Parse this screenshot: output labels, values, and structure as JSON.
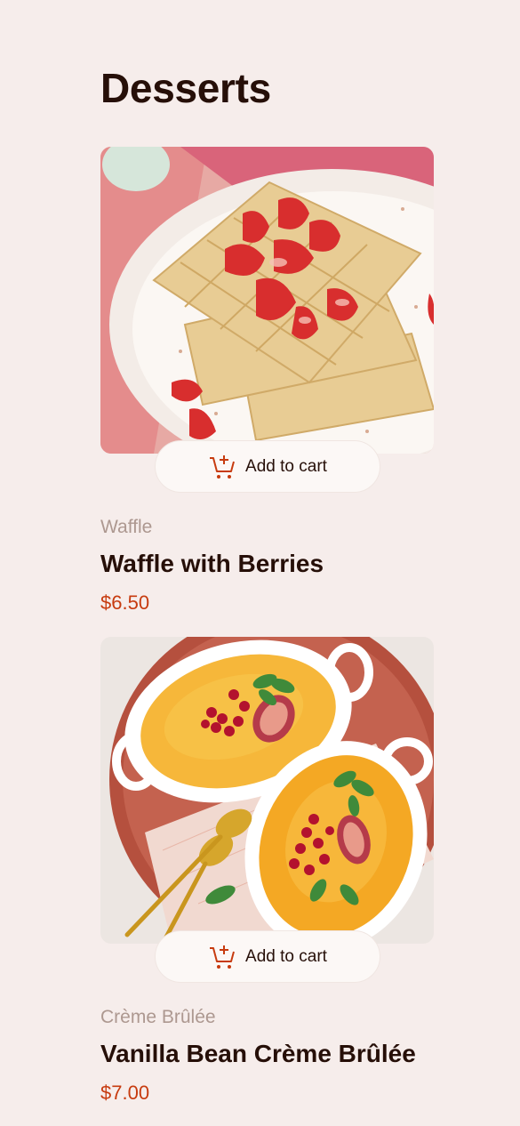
{
  "page": {
    "title": "Desserts"
  },
  "products": [
    {
      "category": "Waffle",
      "name": "Waffle with Berries",
      "price": "$6.50",
      "add_label": "Add to cart",
      "image_alt": "waffle-photo"
    },
    {
      "category": "Crème Brûlée",
      "name": "Vanilla Bean Crème Brûlée",
      "price": "$7.00",
      "add_label": "Add to cart",
      "image_alt": "creme-brulee-photo"
    }
  ],
  "colors": {
    "background": "#F6EDEB",
    "text": "#260F08",
    "category": "#AD9890",
    "accent": "#C73B0F",
    "button_bg": "#FCF8F6"
  },
  "icons": {
    "cart": "add-to-cart-icon"
  }
}
